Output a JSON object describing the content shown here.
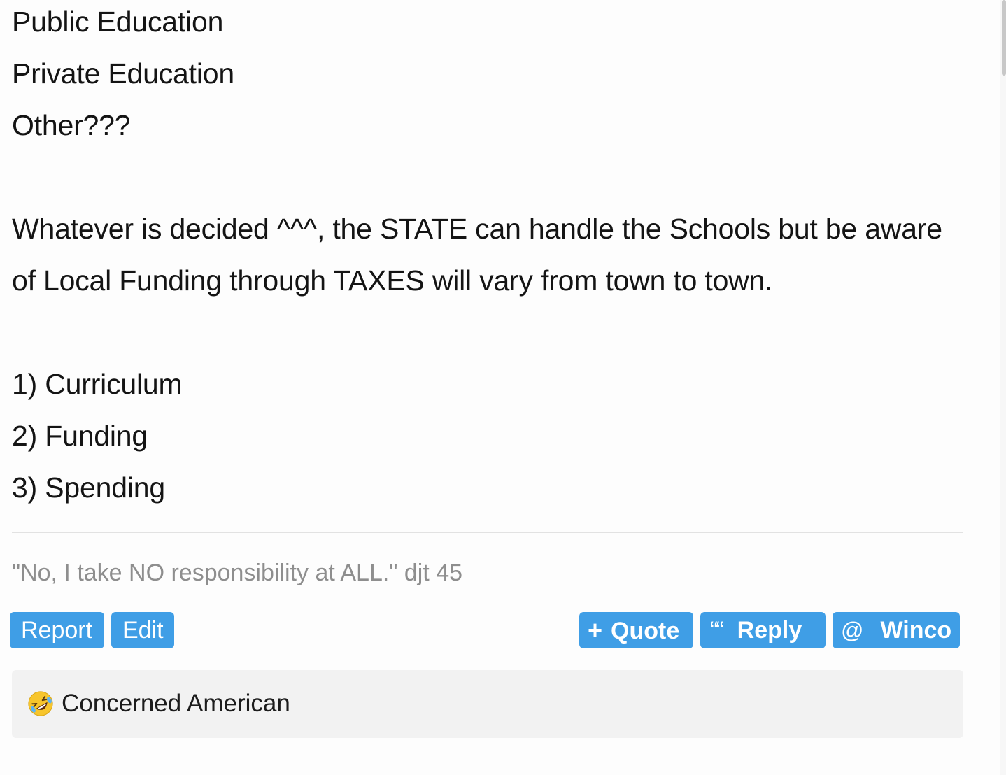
{
  "post": {
    "lines": [
      "Public Education",
      "Private Education",
      "Other???",
      "Whatever is decided ^^^, the STATE can handle the Schools but be aware",
      "of Local Funding through TAXES will vary from town to town.",
      "1) Curriculum",
      "2) Funding",
      "3) Spending"
    ],
    "signature": "\"No, I take NO responsibility at ALL.\" djt 45"
  },
  "actions": {
    "report_label": "Report",
    "edit_label": "Edit",
    "quote_label": "Quote",
    "quote_icon": "plus-icon",
    "reply_label": "Reply",
    "reply_icon": "quote-marks-icon",
    "mention_label": "Winco",
    "mention_icon": "at-icon",
    "button_color": "#3f9ee6"
  },
  "reactions": {
    "emoji": "rolling-on-floor-laughing-icon",
    "user": "Concerned American"
  }
}
